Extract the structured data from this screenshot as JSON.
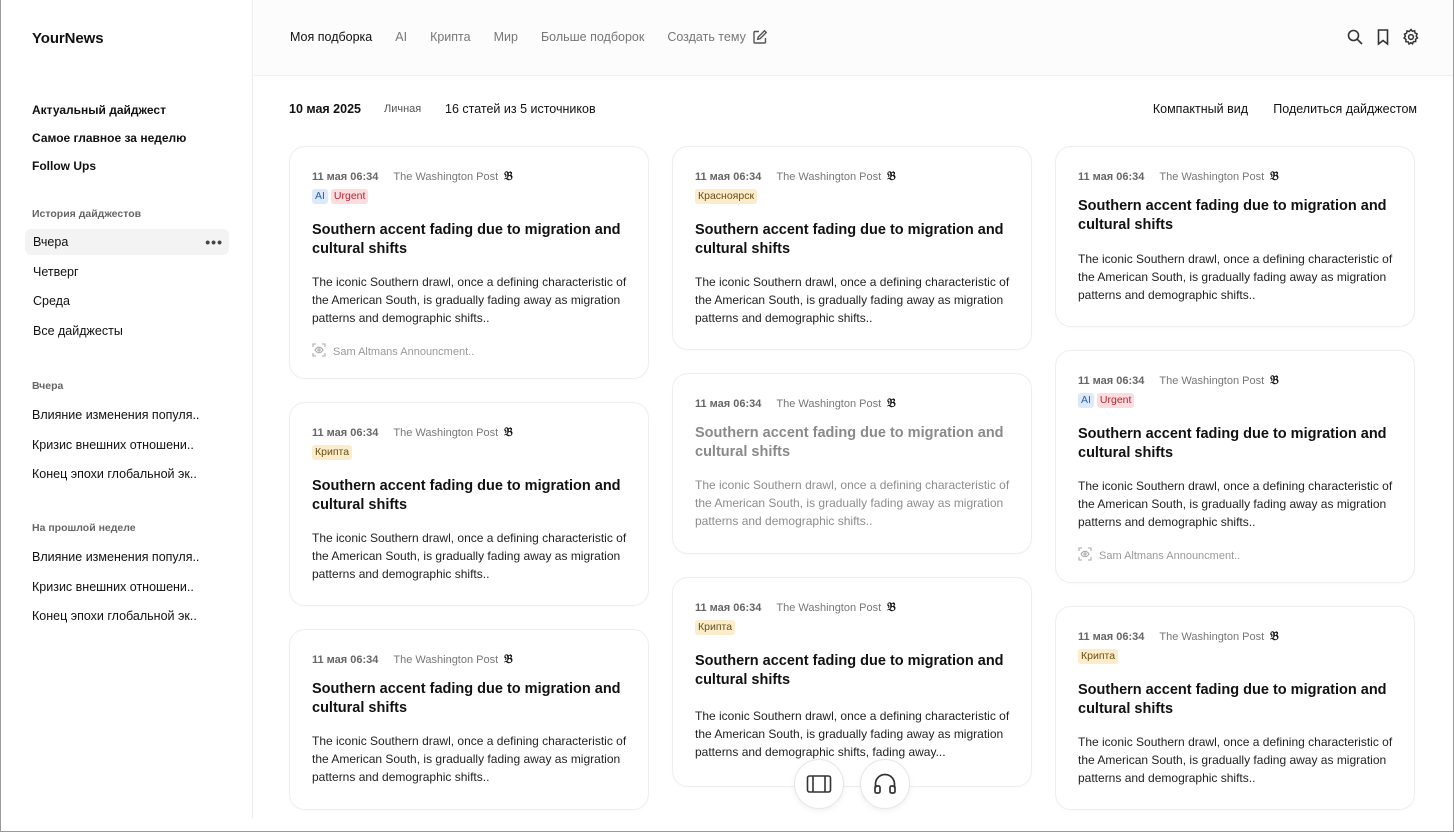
{
  "app": {
    "name": "YourNews"
  },
  "sidebar": {
    "main_links": [
      "Актуальный дайджест",
      "Самое главное за неделю",
      "Follow Ups"
    ],
    "history_title": "История дайджестов",
    "history": [
      "Вчера",
      "Четверг",
      "Среда",
      "Все дайджесты"
    ],
    "yesterday_title": "Вчера",
    "yesterday": [
      "Влияние изменения популя..",
      "Кризис внешних отношени..",
      "Конец эпохи глобальной эк.."
    ],
    "lastweek_title": "На прошлой неделе",
    "lastweek": [
      "Влияние изменения популя..",
      "Кризис внешних отношени..",
      "Конец эпохи глобальной эк.."
    ]
  },
  "topbar": {
    "tabs": [
      "Моя подборка",
      "AI",
      "Крипта",
      "Мир",
      "Больше подборок"
    ],
    "create_label": "Создать тему"
  },
  "digest": {
    "date": "10 мая 2025",
    "type": "Личная",
    "count": "16 статей из 5 источников",
    "compact": "Компактный вид",
    "share": "Поделиться дайджестом"
  },
  "cards": [
    {
      "time": "11 мая 06:34",
      "source": "The Washington Post",
      "source_icon": "𝔅",
      "tags": [
        "AI",
        "Urgent"
      ],
      "title": "Southern accent fading due to migration and cultural shifts",
      "body": "The iconic Southern drawl, once a defining characteristic of the American South, is gradually fading away as migration patterns and demographic shifts..",
      "footer": "Sam Altmans Announcment.."
    },
    {
      "time": "11 мая 06:34",
      "source": "The Washington Post",
      "source_icon": "𝔅",
      "tags": [
        "Крипта"
      ],
      "title": "Southern accent fading due to migration and cultural shifts",
      "body": "The iconic Southern drawl, once a defining characteristic of the American South, is gradually fading away as migration patterns and demographic shifts.."
    },
    {
      "time": "11 мая 06:34",
      "source": "The Washington Post",
      "source_icon": "𝔅",
      "title": "Southern accent fading due to migration and cultural shifts",
      "body": "The iconic Southern drawl, once a defining characteristic of the American South, is gradually fading away as migration patterns and demographic shifts.."
    },
    {
      "time": "11 мая 06:34",
      "source": "The Washington Post",
      "source_icon": "𝔅",
      "tags": [
        "Красноярск"
      ],
      "title": "Southern accent fading due to migration and cultural shifts",
      "body": "The iconic Southern drawl, once a defining characteristic of the American South, is gradually fading away as migration patterns and demographic shifts.."
    },
    {
      "time": "11 мая 06:34",
      "source": "The Washington Post",
      "source_icon": "𝔅",
      "title": "Southern accent fading due to migration and cultural shifts",
      "body": "The iconic Southern drawl, once a defining characteristic of the American South, is gradually fading away as migration patterns and demographic shifts.."
    },
    {
      "time": "11 мая 06:34",
      "source": "The Washington Post",
      "source_icon": "𝔅",
      "tags": [
        "Крипта"
      ],
      "title": "Southern accent fading due to migration and cultural shifts",
      "body": "The iconic Southern drawl, once a defining characteristic of the American South, is gradually fading away as migration patterns and demographic shifts, fading away..."
    },
    {
      "time": "11 мая 06:34",
      "source": "The Washington Post",
      "source_icon": "𝔅",
      "title": "Southern accent fading due to migration and cultural shifts",
      "body": "The iconic Southern drawl, once a defining characteristic of the American South, is gradually fading away as migration patterns and demographic shifts.."
    },
    {
      "time": "11 мая 06:34",
      "source": "The Washington Post",
      "source_icon": "𝔅",
      "tags": [
        "AI",
        "Urgent"
      ],
      "title": "Southern accent fading due to migration and cultural shifts",
      "body": "The iconic Southern drawl, once a defining characteristic of the American South, is gradually fading away as migration patterns and demographic shifts..",
      "footer": "Sam Altmans Announcment.."
    },
    {
      "time": "11 мая 06:34",
      "source": "The Washington Post",
      "source_icon": "𝔅",
      "tags": [
        "Крипта"
      ],
      "title": "Southern accent fading due to migration and cultural shifts",
      "body": "The iconic Southern drawl, once a defining characteristic of the American South, is gradually fading away as migration patterns and demographic shifts.."
    }
  ],
  "icons": {
    "search": "search-icon",
    "bookmark": "bookmark-icon",
    "settings": "gear-icon",
    "edit": "edit-icon",
    "more": "more-dots-icon",
    "eye": "eye-icon",
    "reader": "reader-mode-icon",
    "audio": "headphones-icon"
  }
}
